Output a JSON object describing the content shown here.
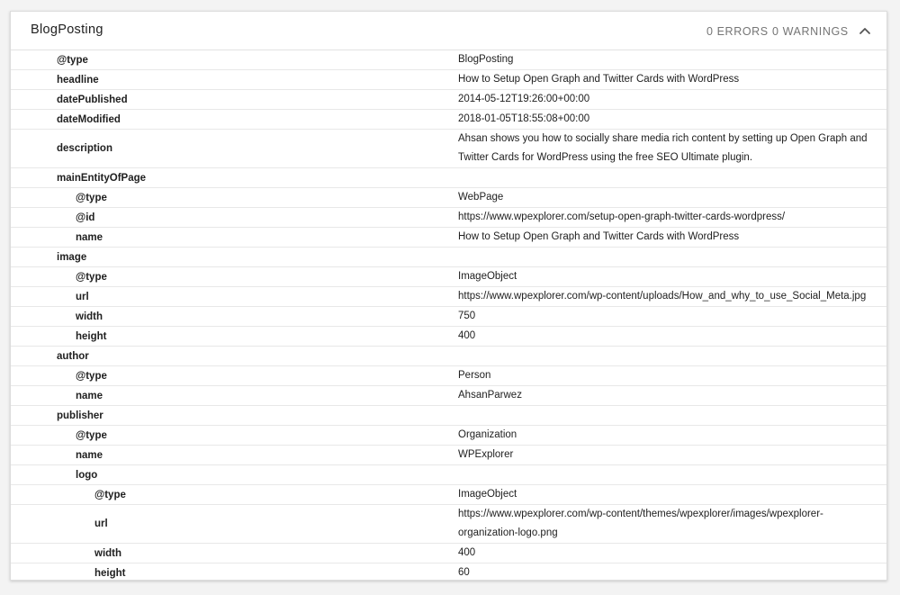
{
  "header": {
    "title": "BlogPosting",
    "errors": "0 ERRORS",
    "warnings": "0 WARNINGS"
  },
  "rows": [
    {
      "key": "@type",
      "value": "BlogPosting"
    },
    {
      "key": "headline",
      "value": "How to Setup Open Graph and Twitter Cards with WordPress"
    },
    {
      "key": "datePublished",
      "value": "2014-05-12T19:26:00+00:00"
    },
    {
      "key": "dateModified",
      "value": "2018-01-05T18:55:08+00:00"
    },
    {
      "key": "description",
      "value": "Ahsan shows you how to socially share media rich content by setting up Open Graph and Twitter Cards for WordPress using the free SEO Ultimate plugin."
    },
    {
      "key": "mainEntityOfPage",
      "value": ""
    },
    {
      "key": "@type",
      "value": "WebPage"
    },
    {
      "key": "@id",
      "value": "https://www.wpexplorer.com/setup-open-graph-twitter-cards-wordpress/"
    },
    {
      "key": "name",
      "value": "How to Setup Open Graph and Twitter Cards with WordPress"
    },
    {
      "key": "image",
      "value": ""
    },
    {
      "key": "@type",
      "value": "ImageObject"
    },
    {
      "key": "url",
      "value": "https://www.wpexplorer.com/wp-content/uploads/How_and_why_to_use_Social_Meta.jpg"
    },
    {
      "key": "width",
      "value": "750"
    },
    {
      "key": "height",
      "value": "400"
    },
    {
      "key": "author",
      "value": ""
    },
    {
      "key": "@type",
      "value": "Person"
    },
    {
      "key": "name",
      "value": "AhsanParwez"
    },
    {
      "key": "publisher",
      "value": ""
    },
    {
      "key": "@type",
      "value": "Organization"
    },
    {
      "key": "name",
      "value": "WPExplorer"
    },
    {
      "key": "logo",
      "value": ""
    },
    {
      "key": "@type",
      "value": "ImageObject"
    },
    {
      "key": "url",
      "value": "https://www.wpexplorer.com/wp-content/themes/wpexplorer/images/wpexplorer-organization-logo.png"
    },
    {
      "key": "width",
      "value": "400"
    },
    {
      "key": "height",
      "value": "60"
    }
  ]
}
